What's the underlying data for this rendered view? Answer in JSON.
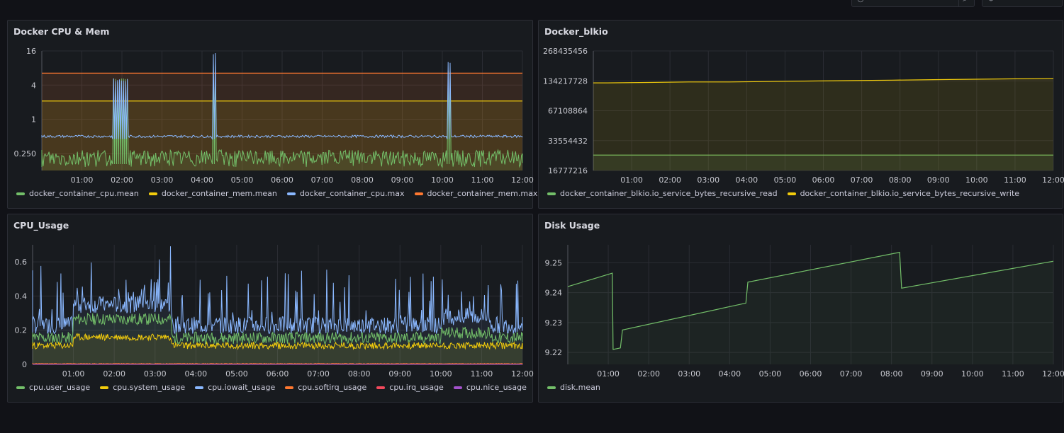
{
  "panels": [
    {
      "id": "docker-cpu-mem",
      "title": "Docker CPU & Mem",
      "legend": [
        {
          "label": "docker_container_cpu.mean",
          "color": "#73bf69"
        },
        {
          "label": "docker_container_mem.mean",
          "color": "#f2cc0c"
        },
        {
          "label": "docker_container_cpu.max",
          "color": "#8ab8ff"
        },
        {
          "label": "docker_container_mem.max",
          "color": "#ff7830"
        }
      ]
    },
    {
      "id": "docker-blkio",
      "title": "Docker_blkio",
      "legend": [
        {
          "label": "docker_container_blkio.io_service_bytes_recursive_read",
          "color": "#73bf69"
        },
        {
          "label": "docker_container_blkio.io_service_bytes_recursive_write",
          "color": "#f2cc0c"
        }
      ]
    },
    {
      "id": "cpu-usage",
      "title": "CPU_Usage",
      "legend": [
        {
          "label": "cpu.user_usage",
          "color": "#73bf69"
        },
        {
          "label": "cpu.system_usage",
          "color": "#f2cc0c"
        },
        {
          "label": "cpu.iowait_usage",
          "color": "#8ab8ff"
        },
        {
          "label": "cpu.softirq_usage",
          "color": "#ff7830"
        },
        {
          "label": "cpu.irq_usage",
          "color": "#f2495c"
        },
        {
          "label": "cpu.nice_usage",
          "color": "#a352cc"
        }
      ]
    },
    {
      "id": "disk-usage",
      "title": "Disk Usage",
      "legend": [
        {
          "label": "disk.mean",
          "color": "#73bf69"
        }
      ]
    }
  ],
  "chart_data": [
    {
      "type": "line",
      "title": "Docker CPU & Mem",
      "y_scale": "log2",
      "ylim": [
        0.125,
        16
      ],
      "y_ticks": [
        "16",
        "4",
        "1",
        "0.250"
      ],
      "x_ticks": [
        "01:00",
        "02:00",
        "03:00",
        "04:00",
        "05:00",
        "06:00",
        "07:00",
        "08:00",
        "09:00",
        "10:00",
        "11:00",
        "12:00"
      ],
      "xlim_hours": [
        0,
        12
      ],
      "series": [
        {
          "name": "docker_container_mem.max",
          "color": "#ff7830",
          "values": [
            {
              "x": 0,
              "y": 6.5
            },
            {
              "x": 12,
              "y": 6.5
            }
          ]
        },
        {
          "name": "docker_container_mem.mean",
          "color": "#f2cc0c",
          "values": [
            {
              "x": 0,
              "y": 2.1
            },
            {
              "x": 12,
              "y": 2.1
            }
          ]
        },
        {
          "name": "docker_container_cpu.max",
          "color": "#8ab8ff",
          "baseline": 0.5,
          "spikes": [
            {
              "from": 1.75,
              "to": 2.15,
              "peak": 5
            },
            {
              "from": 4.25,
              "to": 4.35,
              "peak": 14
            },
            {
              "from": 10.1,
              "to": 10.2,
              "peak": 10
            }
          ]
        },
        {
          "name": "docker_container_cpu.mean",
          "color": "#73bf69",
          "baseline": 0.18,
          "spikes": [
            {
              "from": 1.75,
              "to": 2.15,
              "peak": 5
            },
            {
              "from": 4.25,
              "to": 4.35,
              "peak": 10
            },
            {
              "from": 10.1,
              "to": 10.2,
              "peak": 8
            }
          ]
        }
      ]
    },
    {
      "type": "line",
      "title": "Docker_blkio",
      "y_scale": "log2",
      "ylim": [
        16777216,
        268435456
      ],
      "y_ticks": [
        "268435456",
        "134217728",
        "67108864",
        "33554432",
        "16777216"
      ],
      "x_ticks": [
        "01:00",
        "02:00",
        "03:00",
        "04:00",
        "05:00",
        "06:00",
        "07:00",
        "08:00",
        "09:00",
        "10:00",
        "11:00",
        "12:00"
      ],
      "xlim_hours": [
        0,
        12
      ],
      "series": [
        {
          "name": "docker_container_blkio.io_service_bytes_recursive_read",
          "color": "#73bf69",
          "values": [
            {
              "x": 0,
              "y": 24000000
            },
            {
              "x": 12,
              "y": 24000000
            }
          ]
        },
        {
          "name": "docker_container_blkio.io_service_bytes_recursive_write",
          "color": "#f2cc0c",
          "values": [
            {
              "x": 0,
              "y": 128000000
            },
            {
              "x": 12,
              "y": 142000000
            }
          ]
        }
      ]
    },
    {
      "type": "line",
      "title": "CPU_Usage",
      "ylim": [
        0,
        0.7
      ],
      "y_ticks": [
        "0",
        "0.2",
        "0.4",
        "0.6"
      ],
      "x_ticks": [
        "01:00",
        "02:00",
        "03:00",
        "04:00",
        "05:00",
        "06:00",
        "07:00",
        "08:00",
        "09:00",
        "10:00",
        "11:00",
        "12:00"
      ],
      "xlim_hours": [
        0,
        12
      ],
      "series": [
        {
          "name": "cpu.iowait_usage",
          "color": "#8ab8ff",
          "approx_mean": 0.25,
          "approx_max": 0.6
        },
        {
          "name": "cpu.user_usage",
          "color": "#73bf69",
          "approx_mean": 0.17
        },
        {
          "name": "cpu.system_usage",
          "color": "#f2cc0c",
          "approx_mean": 0.11
        },
        {
          "name": "cpu.softirq_usage",
          "color": "#ff7830",
          "approx_mean": 0.002
        },
        {
          "name": "cpu.irq_usage",
          "color": "#f2495c",
          "approx_mean": 0
        },
        {
          "name": "cpu.nice_usage",
          "color": "#a352cc",
          "approx_mean": 0
        }
      ]
    },
    {
      "type": "line",
      "title": "Disk Usage",
      "ylim": [
        9.216,
        9.256
      ],
      "y_ticks": [
        "9.25",
        "9.24",
        "9.23",
        "9.22"
      ],
      "x_ticks": [
        "01:00",
        "02:00",
        "03:00",
        "04:00",
        "05:00",
        "06:00",
        "07:00",
        "08:00",
        "09:00",
        "10:00",
        "11:00",
        "12:00"
      ],
      "xlim_hours": [
        0,
        12
      ],
      "series": [
        {
          "name": "disk.mean",
          "color": "#73bf69",
          "values": [
            {
              "x": -0.7,
              "y": 9.242
            },
            {
              "x": 1.1,
              "y": 9.2465
            },
            {
              "x": 1.12,
              "y": 9.221
            },
            {
              "x": 1.3,
              "y": 9.2215
            },
            {
              "x": 1.35,
              "y": 9.2275
            },
            {
              "x": 4.4,
              "y": 9.2365
            },
            {
              "x": 4.45,
              "y": 9.2435
            },
            {
              "x": 8.2,
              "y": 9.2535
            },
            {
              "x": 8.25,
              "y": 9.2415
            },
            {
              "x": 12,
              "y": 9.2505
            }
          ]
        }
      ]
    }
  ]
}
